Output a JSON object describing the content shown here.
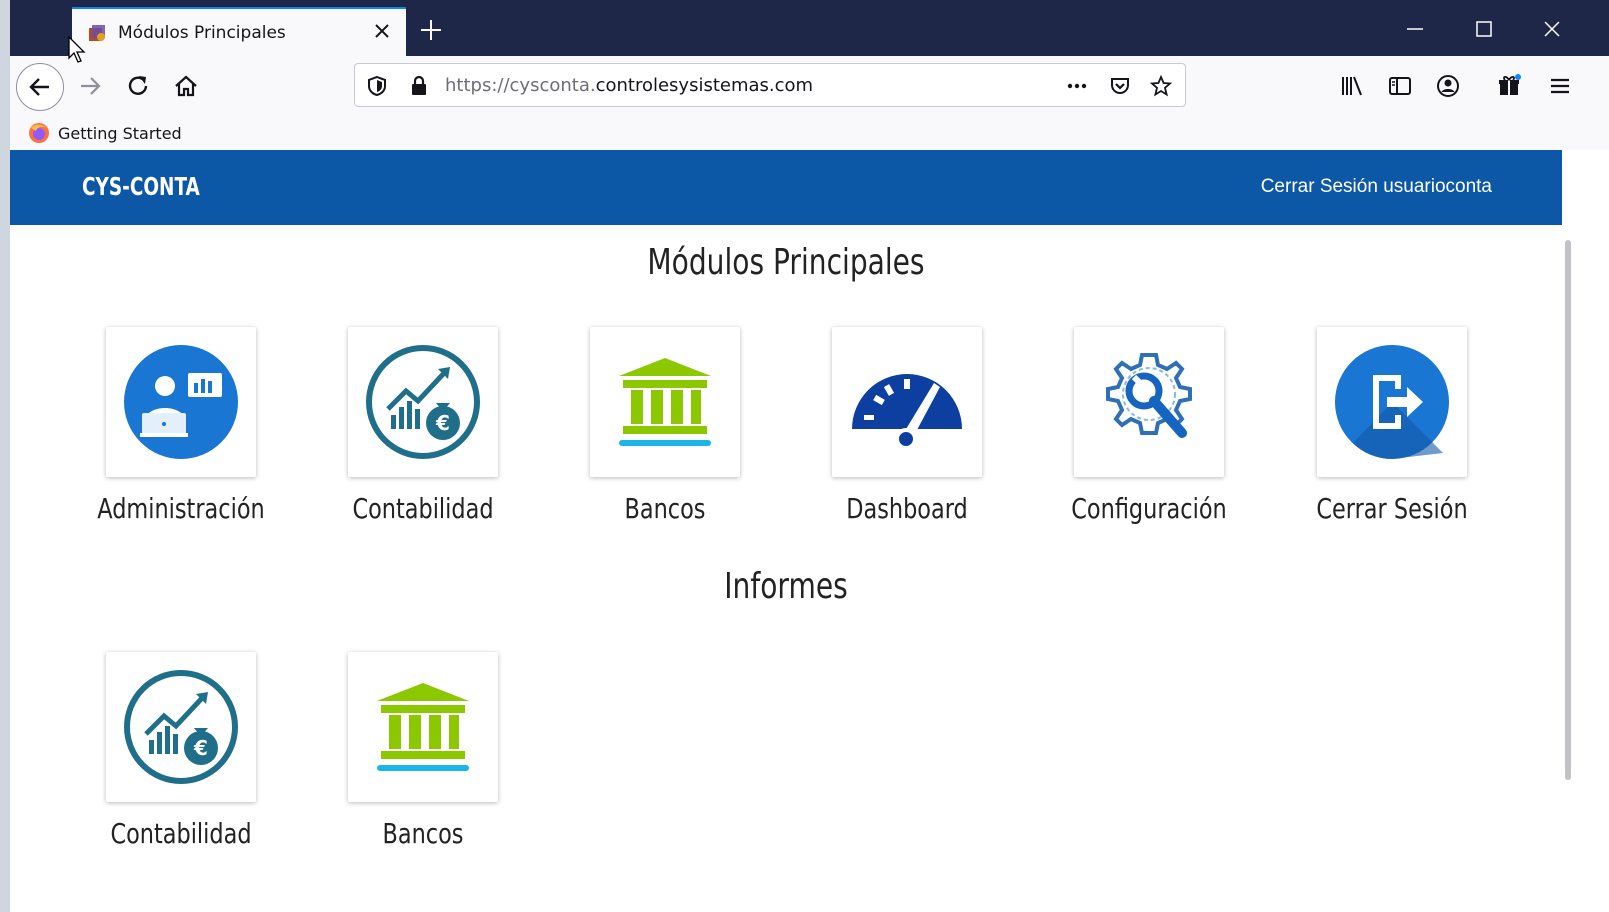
{
  "browser": {
    "tab_title": "Módulos Principales",
    "url_prefix": "https://cysconta.",
    "url_host": "controlesysistemas.com",
    "bookmark_label": "Getting Started"
  },
  "header": {
    "brand": "CYS-CONTA",
    "logout_label": "Cerrar Sesión usuarioconta",
    "color": "#0c58a6"
  },
  "main_section": {
    "title": "Módulos Principales",
    "modules": [
      {
        "label": "Administración",
        "icon": "administration-icon"
      },
      {
        "label": "Contabilidad",
        "icon": "accounting-icon"
      },
      {
        "label": "Bancos",
        "icon": "bank-icon"
      },
      {
        "label": "Dashboard",
        "icon": "dashboard-gauge-icon"
      },
      {
        "label": "Configuración",
        "icon": "settings-wrench-icon"
      },
      {
        "label": "Cerrar Sesión",
        "icon": "logout-icon"
      }
    ]
  },
  "reports_section": {
    "title": "Informes",
    "modules": [
      {
        "label": "Contabilidad",
        "icon": "accounting-icon"
      },
      {
        "label": "Bancos",
        "icon": "bank-icon"
      }
    ]
  },
  "colors": {
    "tabstrip": "#1f2748",
    "accent_blue": "#1976d2",
    "teal": "#1f6f8b",
    "bank_green": "#8cc800",
    "bank_cyan": "#1ab6e8",
    "dashboard_navy": "#0d3fa0"
  }
}
